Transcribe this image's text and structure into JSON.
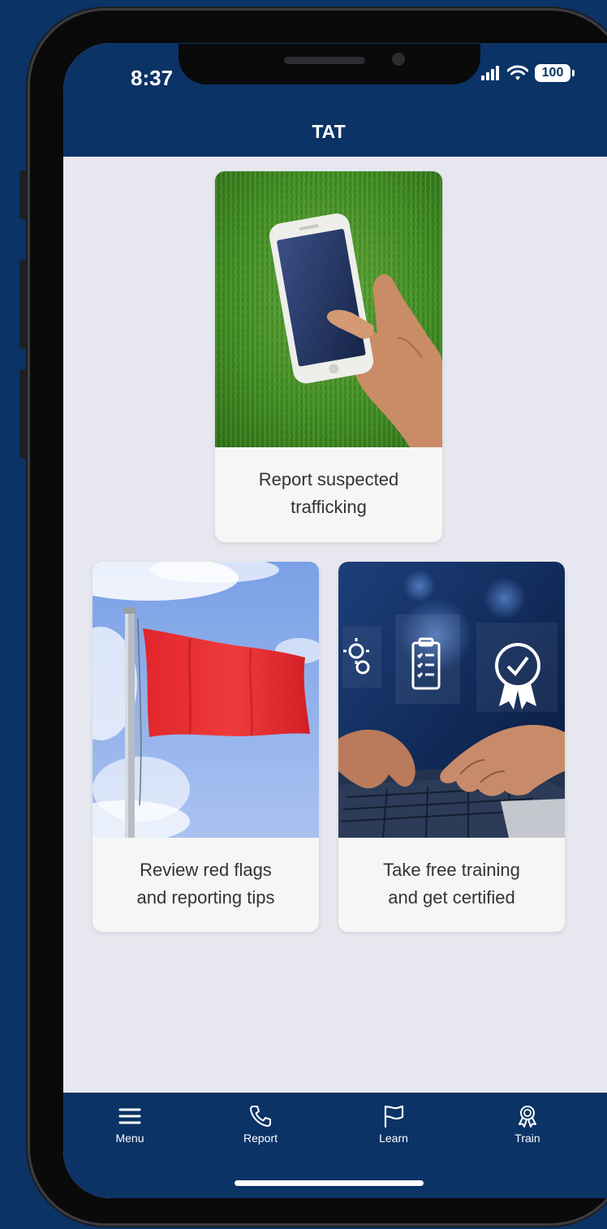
{
  "status_bar": {
    "time": "8:37",
    "battery": "100"
  },
  "header": {
    "title": "TAT"
  },
  "cards": [
    {
      "id": "report",
      "label": "Report suspected\ntrafficking",
      "image": "hand-holding-phone-on-grass"
    },
    {
      "id": "red-flags",
      "label": "Review red flags\nand reporting tips",
      "image": "red-flag-on-pole-sky"
    },
    {
      "id": "training",
      "label": "Take free training\nand get certified",
      "image": "hands-typing-laptop-with-certificate-icons"
    }
  ],
  "tabs": [
    {
      "label": "Menu",
      "icon": "menu-icon"
    },
    {
      "label": "Report",
      "icon": "phone-icon"
    },
    {
      "label": "Learn",
      "icon": "flag-icon"
    },
    {
      "label": "Train",
      "icon": "award-icon"
    }
  ],
  "colors": {
    "brand_navy": "#0b3366",
    "screen_bg": "#e7e8ef",
    "card_bg": "#f6f6f6",
    "flag_red": "#e1262c"
  }
}
